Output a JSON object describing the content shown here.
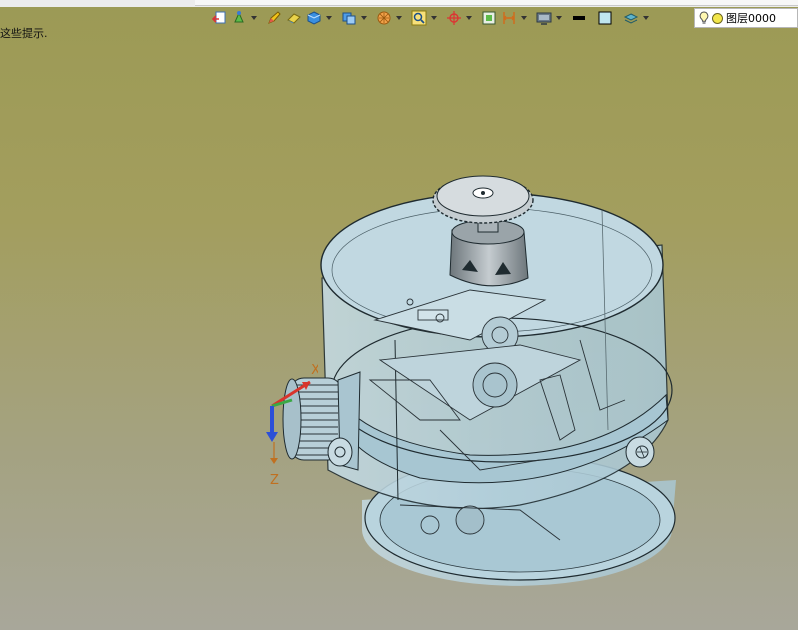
{
  "hint": "这些提示.",
  "layer_selector": {
    "label": "图层0000"
  },
  "triad": {
    "x_label": "X",
    "z_label": "Z"
  },
  "toolbar_icons": [
    "view-restore-icon",
    "sketch-point-icon",
    "pencil-icon",
    "eraser-icon",
    "solid-cube-icon",
    "view-cube-icon",
    "render-mode-icon",
    "zoom-icon",
    "snap-target-icon",
    "frame-icon",
    "dimension-icon",
    "monitor-icon",
    "line-color-icon",
    "fill-color-icon",
    "layer-stack-icon"
  ],
  "colors": {
    "background_top": "#9c9a55",
    "background_bottom": "#a8a79a",
    "model_fill": "#b7d3de",
    "model_edge": "#1f2b30"
  }
}
